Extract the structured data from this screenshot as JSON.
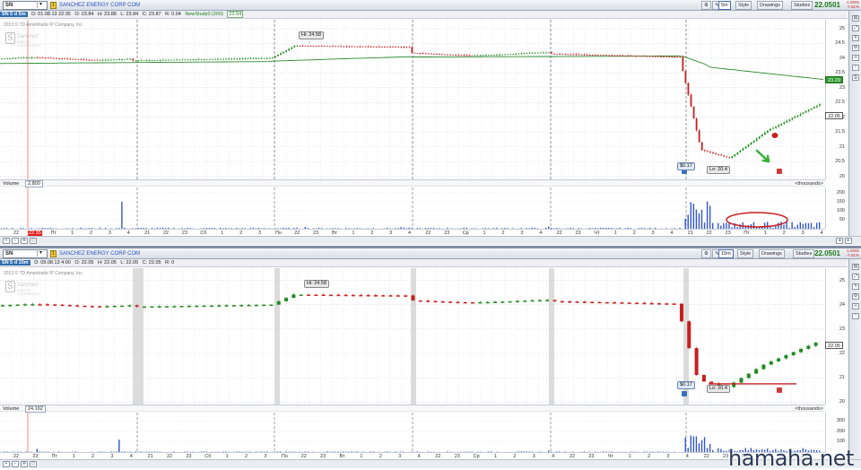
{
  "panes": [
    {
      "symbol": "SN",
      "company": "SANCHEZ ENERGY CORP COM",
      "interval": "5m",
      "style_label": "Style",
      "drawings_label": "Drawings",
      "studies_label": "Studies",
      "last_price": "22.0501",
      "change_lines": [
        "-1.0000",
        "-7.61%"
      ],
      "info": {
        "sym": "SN 5 d 5m",
        "d": "D: 01.08.13 22:35",
        "o": "O: 23.84",
        "h": "H: 23.88",
        "l": "L: 23.84",
        "c": "C: 23.87",
        "r": "R: 0.04",
        "study": "NewStudy0 (200)",
        "study_val": "23.54"
      },
      "copyright": "2013 © TD Ameritrade IP Company, Inc.",
      "logo_text": "Sanchez",
      "logo_sub": "ENERGY CORPORATION",
      "y_ticks": [
        "25",
        "24.5",
        "24",
        "23.5",
        "23",
        "22.5",
        "22",
        "21.5",
        "21",
        "20.5",
        "20"
      ],
      "price_tag": "22.05",
      "study_tag": "23.29",
      "hi_label": "Hi: 24.58",
      "lo_label": "Lo: 20.4",
      "buy_label": "$0.17",
      "volume": {
        "label": "Volume",
        "value": "2,800",
        "units": "<thousands>",
        "y_ticks": [
          "200",
          "150",
          "100",
          "50"
        ]
      },
      "x_ticks": [
        "22",
        "22:35",
        "Пт",
        "1",
        "2",
        "3",
        "4",
        "21",
        "22",
        "23",
        "Сб",
        "1",
        "2",
        "3",
        "Пн",
        "22",
        "23",
        "Вт",
        "1",
        "2",
        "3",
        "4",
        "22",
        "23",
        "Ср",
        "1",
        "2",
        "3",
        "4",
        "22",
        "23",
        "Чт",
        "1",
        "2",
        "3",
        "4",
        "21",
        "22",
        "23",
        "Пт",
        "1",
        "2",
        "3",
        "4"
      ],
      "colors": {
        "study_line": "#2e8b2e",
        "up": "#1f8a1f",
        "down": "#c81e1e",
        "highlight_ellipse": "#c81e1e",
        "arrow": "#35b035"
      }
    },
    {
      "symbol": "SN",
      "company": "SANCHEZ ENERGY CORP COM",
      "interval": "15m",
      "style_label": "Style",
      "drawings_label": "Drawings",
      "studies_label": "Studies",
      "last_price": "22.0501",
      "change_lines": [
        "-1.0000",
        "-7.61%"
      ],
      "info": {
        "sym": "SN 5 d 15m",
        "d": "D: 09.08.13 4:00",
        "o": "O: 22.05",
        "h": "H: 22.05",
        "l": "L: 22.05",
        "c": "C: 22.05",
        "r": "R: 0"
      },
      "copyright": "2013 © TD Ameritrade IP Company, Inc.",
      "logo_text": "Sanchez",
      "logo_sub": "ENERGY CORPORATION",
      "y_ticks": [
        "25",
        "24",
        "23",
        "22",
        "21",
        "20"
      ],
      "price_tag": "22.05",
      "hi_label": "Hi: 24.58",
      "lo_label": "Lo: 20.4",
      "buy_label": "$0.17",
      "volume": {
        "label": "Volume",
        "value": "24,162",
        "units": "<thousands>",
        "y_ticks": [
          "300",
          "200",
          "100"
        ]
      },
      "x_ticks": [
        "22",
        "23",
        "Пт",
        "1",
        "2",
        "3",
        "4",
        "21",
        "22",
        "23",
        "Сб",
        "1",
        "2",
        "3",
        "Пн",
        "22",
        "23",
        "Вт",
        "1",
        "2",
        "3",
        "4",
        "22",
        "23",
        "Ср",
        "1",
        "2",
        "3",
        "4",
        "22",
        "23",
        "Чт",
        "1",
        "2",
        "3",
        "4",
        "22",
        "23",
        "Пт",
        "1",
        "2",
        "3",
        "4"
      ],
      "colors": {
        "up": "#1f8a1f",
        "down": "#c81e1e",
        "support_line": "#c81e1e"
      }
    }
  ],
  "watermark": "hamaha.net"
}
